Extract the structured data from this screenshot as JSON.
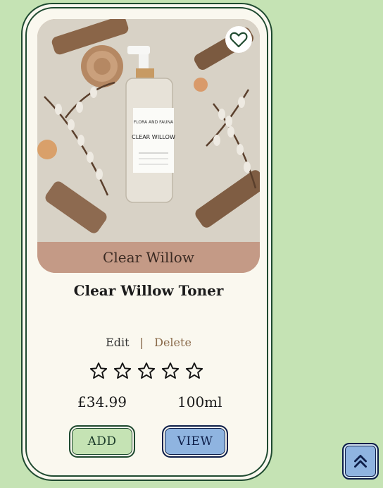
{
  "product": {
    "image_alt": "Clear Willow toner bottle surrounded by driftwood and pussy willow",
    "bottle_brand": "FLORA AND FAUNA",
    "bottle_name": "CLEAR WILLOW",
    "caption": "Clear Willow",
    "title": "Clear Willow Toner",
    "price": "£34.99",
    "size": "100ml",
    "rating": 0,
    "rating_max": 5,
    "favorite_icon": "heart-outline-icon"
  },
  "actions": {
    "edit_label": "Edit",
    "separator": "|",
    "delete_label": "Delete"
  },
  "buttons": {
    "add_label": "ADD",
    "view_label": "VIEW"
  },
  "scroll_top": {
    "icon": "double-chevron-up-icon"
  },
  "colors": {
    "page_bg": "#c5e3b4",
    "card_bg": "#faf8ef",
    "border_green": "#1f4a30",
    "caption_bg": "#c49a86",
    "view_blue": "#8fb4e0",
    "navy": "#0e1f4a"
  }
}
